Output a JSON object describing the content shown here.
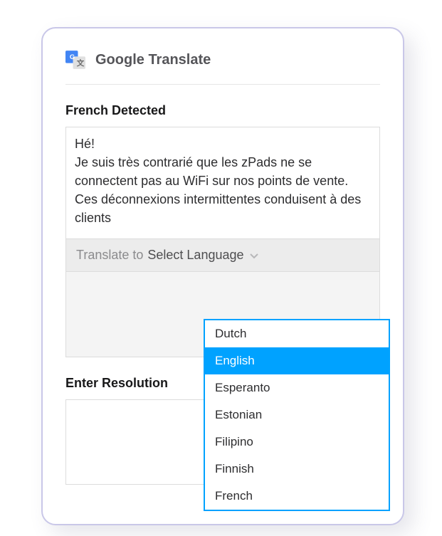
{
  "header": {
    "title": "Google Translate"
  },
  "detect": {
    "label": "French Detected"
  },
  "source": {
    "text": "Hé!\nJe suis très contrarié que les zPads ne se connectent pas au WiFi sur nos points de vente. Ces déconnexions intermittentes conduisent à des clients"
  },
  "translate": {
    "label": "Translate to",
    "selected": "Select Language"
  },
  "languages": {
    "items": [
      "Dutch",
      "English",
      "Esperanto",
      "Estonian",
      "Filipino",
      "Finnish",
      "French"
    ],
    "highlighted": "English"
  },
  "resolution": {
    "label": "Enter Resolution"
  }
}
